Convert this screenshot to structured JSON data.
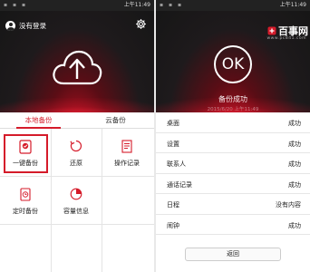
{
  "status_bar": {
    "left_time": "上午11:49",
    "right_time": "上午11:49"
  },
  "left": {
    "user_label": "没有登录",
    "tabs": [
      {
        "label": "本地备份",
        "active": true
      },
      {
        "label": "云备份",
        "active": false
      }
    ],
    "grid": [
      {
        "label": "一键备份",
        "icon": "one-key-backup-icon",
        "selected": true
      },
      {
        "label": "还原",
        "icon": "restore-icon",
        "selected": false
      },
      {
        "label": "操作记录",
        "icon": "operation-log-icon",
        "selected": false
      },
      {
        "label": "定时备份",
        "icon": "scheduled-backup-icon",
        "selected": false
      },
      {
        "label": "容量信息",
        "icon": "capacity-pie-icon",
        "selected": false
      }
    ]
  },
  "right": {
    "brand_name": "百事网",
    "brand_url": "www.pc841.com",
    "ok_text": "OK",
    "result_title": "备份成功",
    "result_time": "2015/6/20 上午11:49",
    "results": [
      {
        "name": "桌面",
        "status": "成功"
      },
      {
        "name": "设置",
        "status": "成功"
      },
      {
        "name": "联系人",
        "status": "成功"
      },
      {
        "name": "通话记录",
        "status": "成功"
      },
      {
        "name": "日程",
        "status": "没有内容"
      },
      {
        "name": "闹钟",
        "status": "成功"
      }
    ],
    "back_label": "返回"
  },
  "colors": {
    "accent": "#d51b2a",
    "dark_bg": "#161616"
  }
}
